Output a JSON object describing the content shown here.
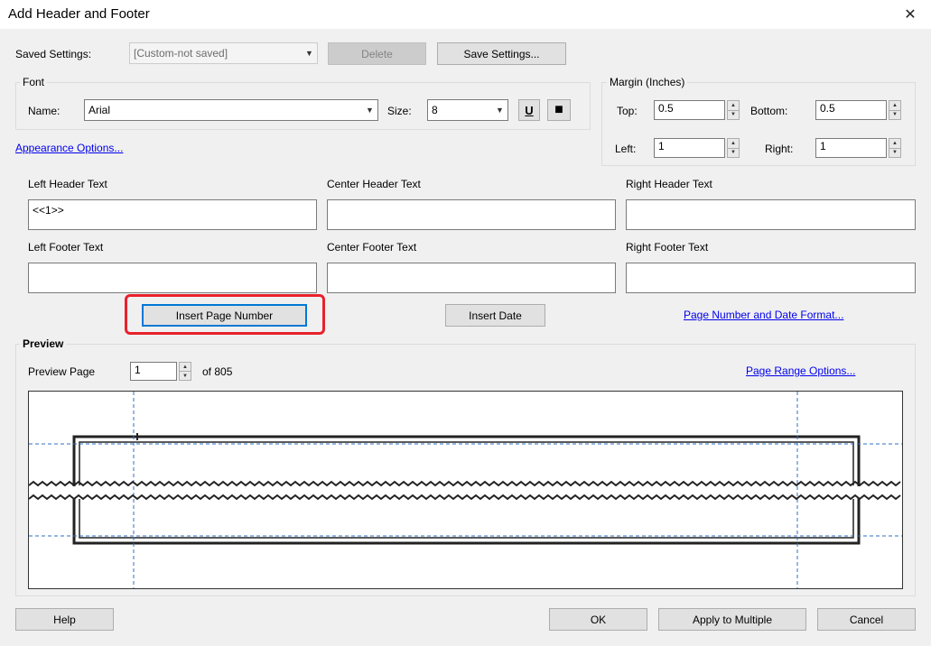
{
  "window": {
    "title": "Add Header and Footer",
    "close_glyph": "✕"
  },
  "saved_settings": {
    "label": "Saved Settings:",
    "value": "[Custom-not saved]",
    "delete_label": "Delete",
    "save_label": "Save Settings..."
  },
  "font": {
    "group_label": "Font",
    "name_label": "Name:",
    "name_value": "Arial",
    "size_label": "Size:",
    "size_value": "8",
    "underline_glyph": "U",
    "color_glyph": "■"
  },
  "margin": {
    "group_label": "Margin (Inches)",
    "top_label": "Top:",
    "top_value": "0.5",
    "bottom_label": "Bottom:",
    "bottom_value": "0.5",
    "left_label": "Left:",
    "left_value": "1",
    "right_label": "Right:",
    "right_value": "1"
  },
  "appearance_link": "Appearance Options...",
  "header_footer": {
    "left_header_label": "Left Header Text",
    "left_header_value": "<<1>>",
    "center_header_label": "Center Header Text",
    "center_header_value": "",
    "right_header_label": "Right Header Text",
    "right_header_value": "",
    "left_footer_label": "Left Footer Text",
    "left_footer_value": "",
    "center_footer_label": "Center Footer Text",
    "center_footer_value": "",
    "right_footer_label": "Right Footer Text",
    "right_footer_value": ""
  },
  "actions": {
    "insert_page_number": "Insert Page Number",
    "insert_date": "Insert Date",
    "format_link": "Page Number and Date Format..."
  },
  "preview": {
    "group_label": "Preview",
    "page_label": "Preview Page",
    "page_value": "1",
    "page_total": "of 805",
    "range_link": "Page Range Options..."
  },
  "footer_buttons": {
    "help": "Help",
    "ok": "OK",
    "apply_multiple": "Apply to Multiple",
    "cancel": "Cancel"
  },
  "colors": {
    "highlight": "#e8212c",
    "link": "#0000ee",
    "focus": "#0078d7",
    "guide": "#2f6fc4"
  }
}
